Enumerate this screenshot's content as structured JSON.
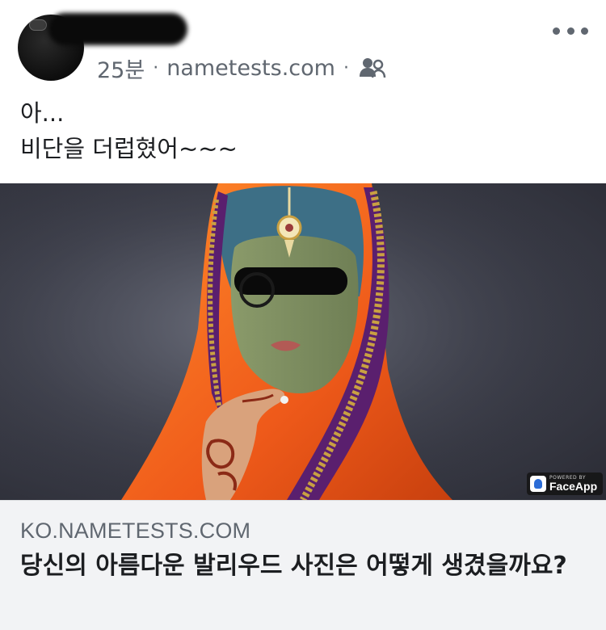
{
  "post": {
    "time": "25분",
    "separator": "·",
    "source": "nametests.com",
    "audience_icon": "friends-icon",
    "more_icon": "more-options-icon",
    "text_line1": "아...",
    "text_line2": "비단을 더럽혔어~~~"
  },
  "image": {
    "badge_small": "POWERED BY",
    "badge_name": "FaceApp"
  },
  "link": {
    "domain": "KO.NAMETESTS.COM",
    "title": "당신의 아름다운 발리우드 사진은 어떻게 생겼을까요?"
  },
  "colors": {
    "meta_text": "#606770",
    "body_text": "#1c1e21",
    "card_background": "#f2f3f5",
    "sari_orange": "#f0641e",
    "sari_purple": "#5a1f6e",
    "trim_gold": "#c9a042"
  }
}
